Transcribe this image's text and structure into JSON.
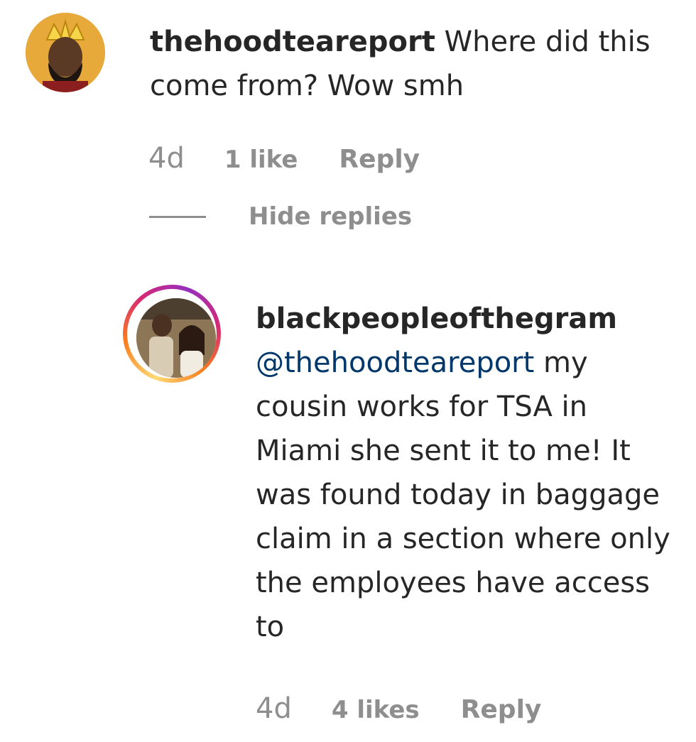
{
  "comment": {
    "username": "thehoodteareport",
    "text": "Where did this come from? Wow smh",
    "age": "4d",
    "likes": "1 like",
    "reply_label": "Reply",
    "hide_replies_label": "Hide replies",
    "avatar_icon": "user-avatar-crown"
  },
  "reply": {
    "username": "blackpeopleofthegram",
    "mention": "@thehoodteareport",
    "text": "my cousin works for TSA in Miami she sent it to me! It was found today in baggage claim in a section where only the employees have access to",
    "age": "4d",
    "likes": "4 likes",
    "reply_label": "Reply",
    "avatar_icon": "user-avatar-story-ring"
  },
  "colors": {
    "text": "#262626",
    "muted": "#8e8e8e",
    "mention": "#00376b"
  }
}
